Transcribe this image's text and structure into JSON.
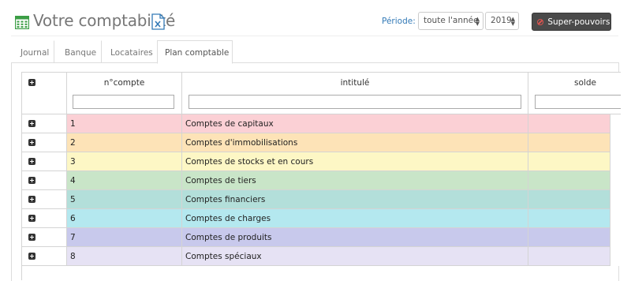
{
  "header": {
    "title": "Votre comptabilité",
    "icons": {
      "app": "calculator-icon",
      "export": "excel-file-icon"
    },
    "periode_label": "Période:",
    "periode_select": "toute l'année",
    "year_select": "2019",
    "super_button": "Super-pouvoirs"
  },
  "tabs": [
    {
      "label": "Journal",
      "active": false
    },
    {
      "label": "Banque",
      "active": false
    },
    {
      "label": "Locataires",
      "active": false
    },
    {
      "label": "Plan comptable",
      "active": true
    }
  ],
  "grid": {
    "columns": [
      {
        "key": "expand",
        "label": ""
      },
      {
        "key": "numero",
        "label": "n°compte"
      },
      {
        "key": "intitule",
        "label": "intitulé"
      },
      {
        "key": "solde",
        "label": "solde"
      }
    ],
    "filters": {
      "numero": "",
      "intitule": "",
      "solde": ""
    },
    "rows": [
      {
        "numero": "1",
        "intitule": "Comptes de capitaux",
        "solde": "",
        "color": "#fbd0d5"
      },
      {
        "numero": "2",
        "intitule": "Comptes d'immobilisations",
        "solde": "",
        "color": "#fde3b7"
      },
      {
        "numero": "3",
        "intitule": "Comptes de stocks et en cours",
        "solde": "",
        "color": "#fdf7c5"
      },
      {
        "numero": "4",
        "intitule": "Comptes de tiers",
        "solde": "",
        "color": "#c9e5c8"
      },
      {
        "numero": "5",
        "intitule": "Comptes financiers",
        "solde": "",
        "color": "#b3dfda"
      },
      {
        "numero": "6",
        "intitule": "Comptes de charges",
        "solde": "",
        "color": "#b4e8ef"
      },
      {
        "numero": "7",
        "intitule": "Comptes de produits",
        "solde": "",
        "color": "#c8c9ec"
      },
      {
        "numero": "8",
        "intitule": "Comptes spéciaux",
        "solde": "",
        "color": "#e6e2f4"
      }
    ]
  },
  "colors": {
    "accent": "#337ab7",
    "title": "#777777",
    "icon_green": "#3c9e46",
    "super_bg": "#4a4a4a",
    "danger": "#d9534f"
  }
}
